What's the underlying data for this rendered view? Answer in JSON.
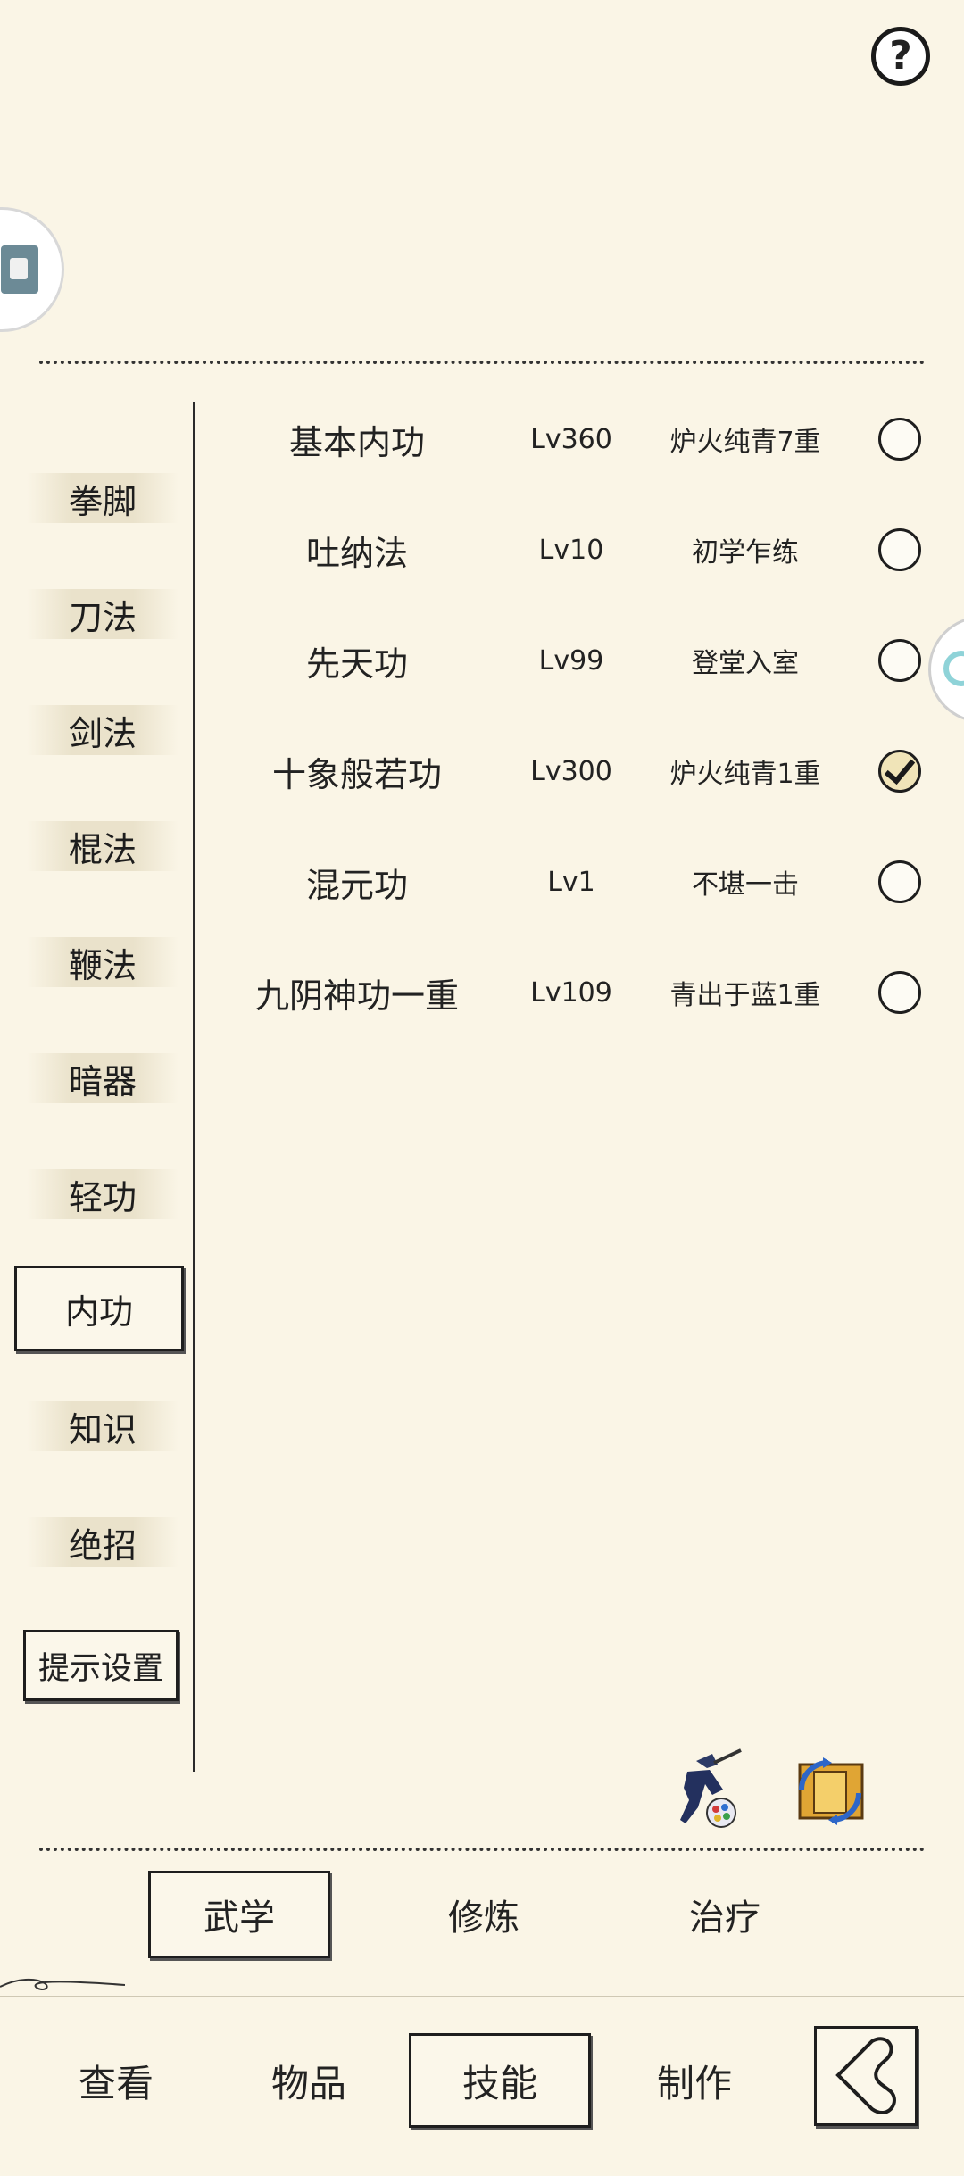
{
  "header": {
    "help_glyph": "?",
    "help_icon": "question-circle-icon"
  },
  "categories": [
    "拳脚",
    "刀法",
    "剑法",
    "棍法",
    "鞭法",
    "暗器",
    "轻功",
    "内功",
    "知识",
    "绝招"
  ],
  "active_category": "内功",
  "hint_settings_label": "提示设置",
  "skills": [
    {
      "name": "基本内功",
      "level": "Lv360",
      "stage": "炉火纯青7重",
      "checked": false
    },
    {
      "name": "吐纳法",
      "level": "Lv10",
      "stage": "初学乍练",
      "checked": false
    },
    {
      "name": "先天功",
      "level": "Lv99",
      "stage": "登堂入室",
      "checked": false
    },
    {
      "name": "十象般若功",
      "level": "Lv300",
      "stage": "炉火纯青1重",
      "checked": true
    },
    {
      "name": "混元功",
      "level": "Lv1",
      "stage": "不堪一击",
      "checked": false
    },
    {
      "name": "九阴神功一重",
      "level": "Lv109",
      "stage": "青出于蓝1重",
      "checked": false
    }
  ],
  "sub_tabs": [
    "武学",
    "修炼",
    "治疗"
  ],
  "active_sub_tab": "武学",
  "bottom_nav": [
    "查看",
    "物品",
    "技能",
    "制作"
  ],
  "active_nav": "技能",
  "colors": {
    "background": "#faf5e6",
    "ink": "#1e1e1e",
    "check_fill": "#f0e4b8"
  }
}
